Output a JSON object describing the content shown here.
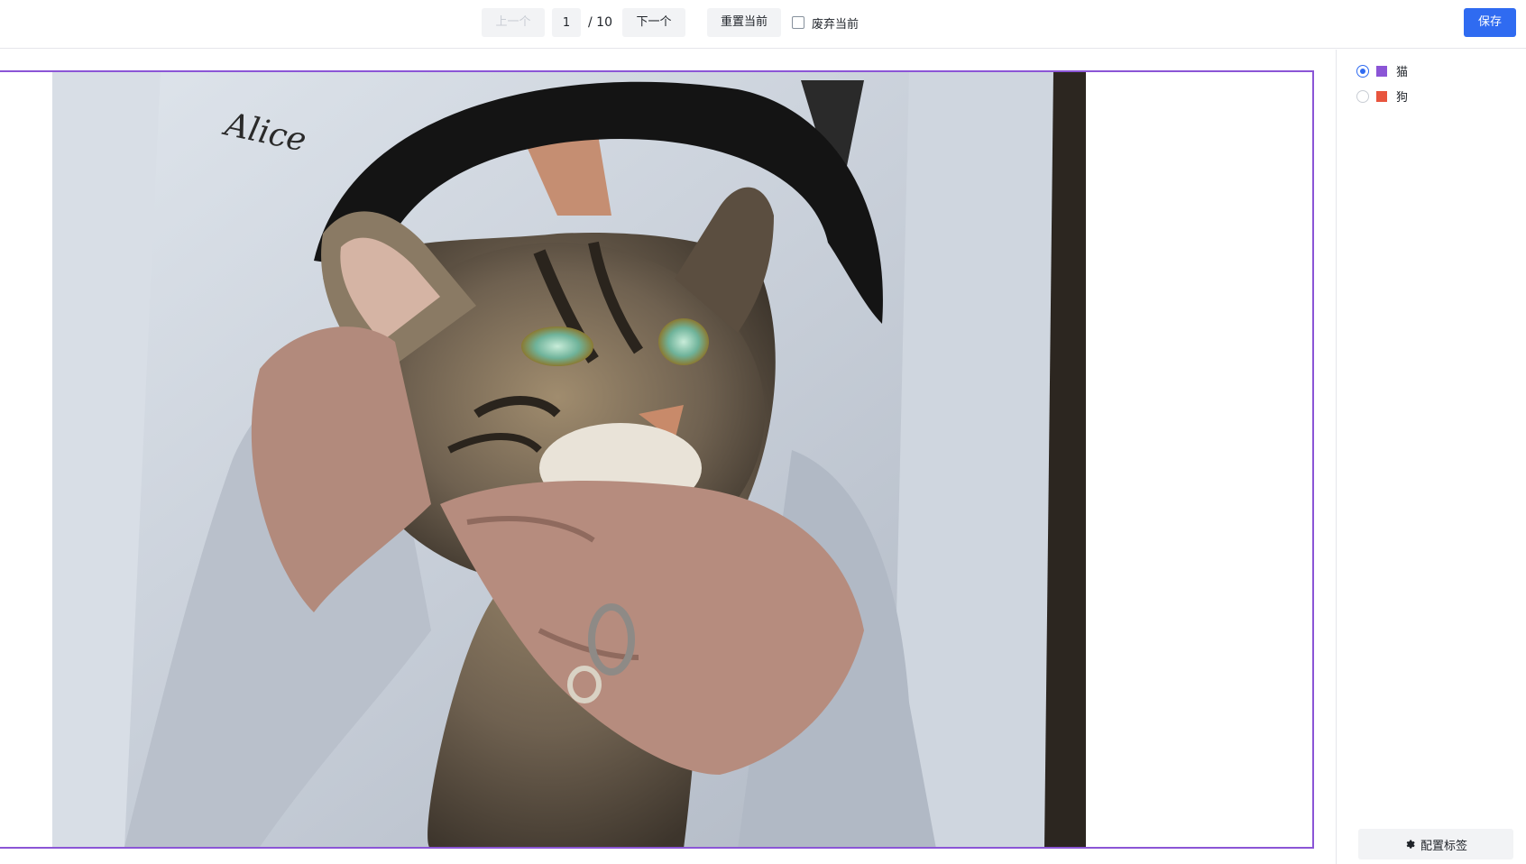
{
  "toolbar": {
    "prev_label": "上一个",
    "page_value": "1",
    "total_label": "/ 10",
    "next_label": "下一个",
    "reset_label": "重置当前",
    "discard_label": "废弃当前",
    "save_label": "保存"
  },
  "labels": [
    {
      "name": "猫",
      "color": "#8b55d6",
      "selected": true
    },
    {
      "name": "狗",
      "color": "#e8553e",
      "selected": false
    }
  ],
  "sidebar": {
    "config_label": "配置标签",
    "config_icon": "gear-icon"
  },
  "image": {
    "subject": "tabby kitten held in hands",
    "annotation_label": "猫",
    "annotation_color": "#8b55d6"
  },
  "colors": {
    "accent": "#2f6bf1",
    "bbox": "#8b55d6"
  }
}
